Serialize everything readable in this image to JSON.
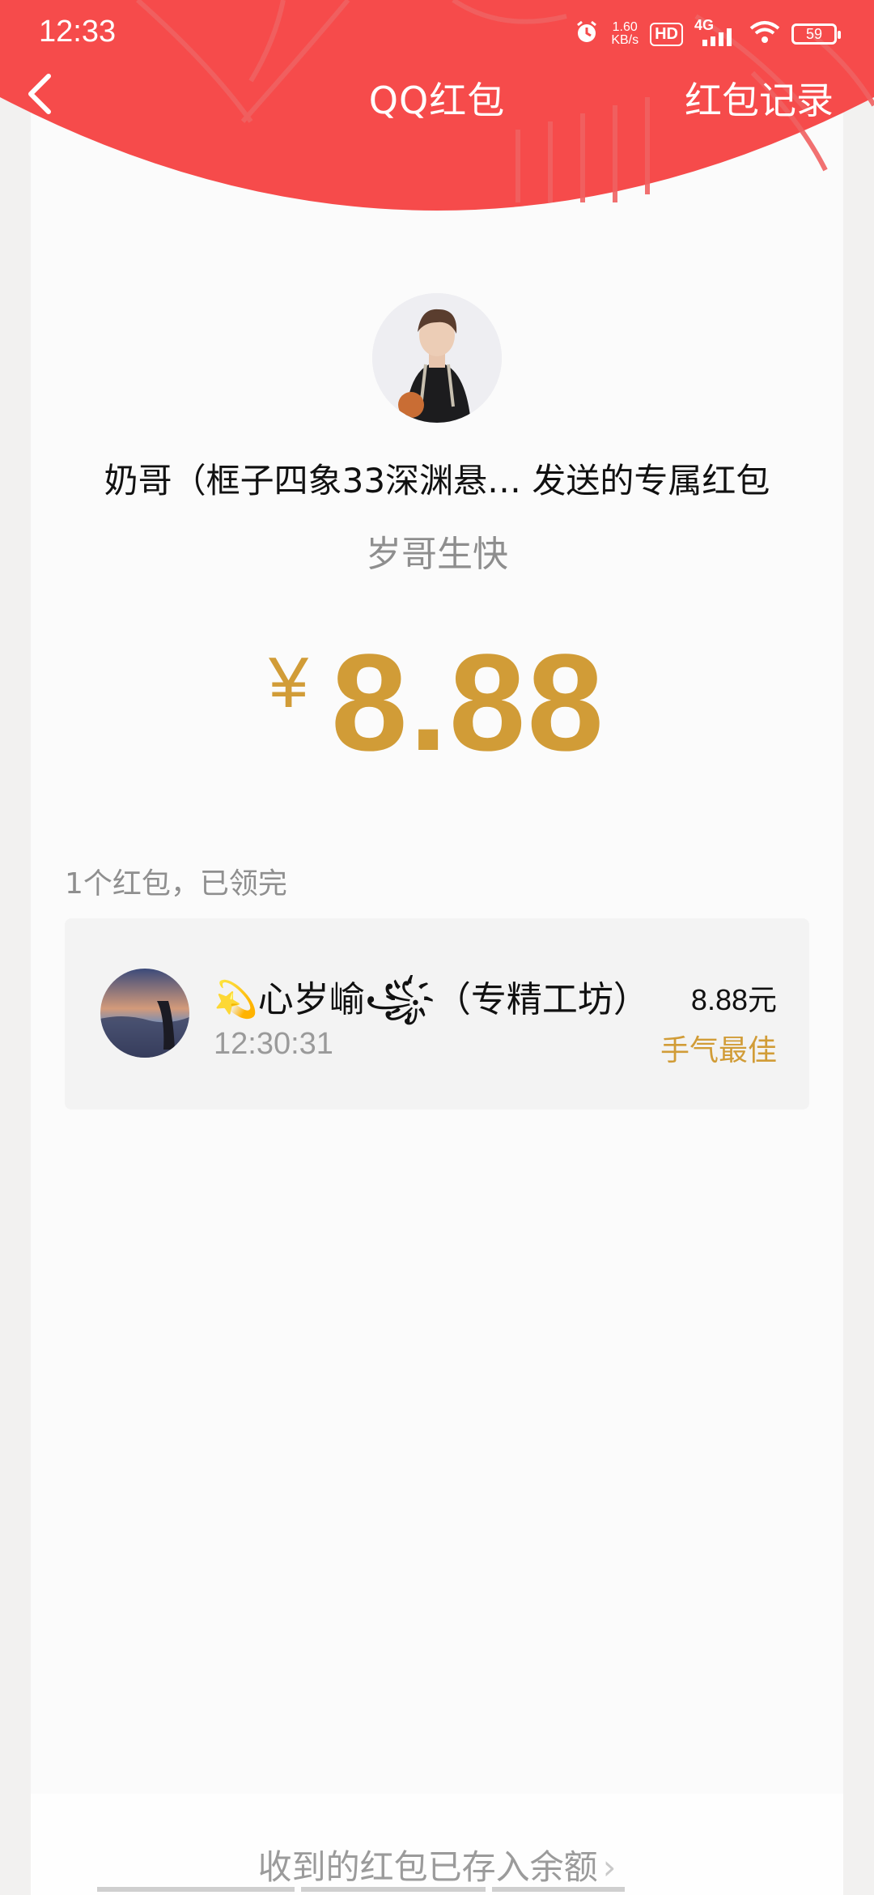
{
  "status_bar": {
    "time": "12:33",
    "net_speed_value": "1.60",
    "net_speed_unit": "KB/s",
    "hd_label": "HD",
    "network": "4G",
    "battery": "59"
  },
  "nav": {
    "title": "QQ红包",
    "record_label": "红包记录"
  },
  "packet": {
    "sender_line": "奶哥（框子四象33深渊悬… 发送的专属红包",
    "greeting": "岁哥生快",
    "currency": "¥",
    "amount": "8.88"
  },
  "summary": "1个红包，已领完",
  "receivers": [
    {
      "name": "💫心岁崳꧁҉（专精工坊）",
      "time": "12:30:31",
      "amount": "8.88元",
      "badge": "手气最佳"
    }
  ],
  "footer": {
    "text": "收到的红包已存入余额"
  },
  "colors": {
    "header_red": "#f64b4b",
    "gold": "#d19c37"
  }
}
